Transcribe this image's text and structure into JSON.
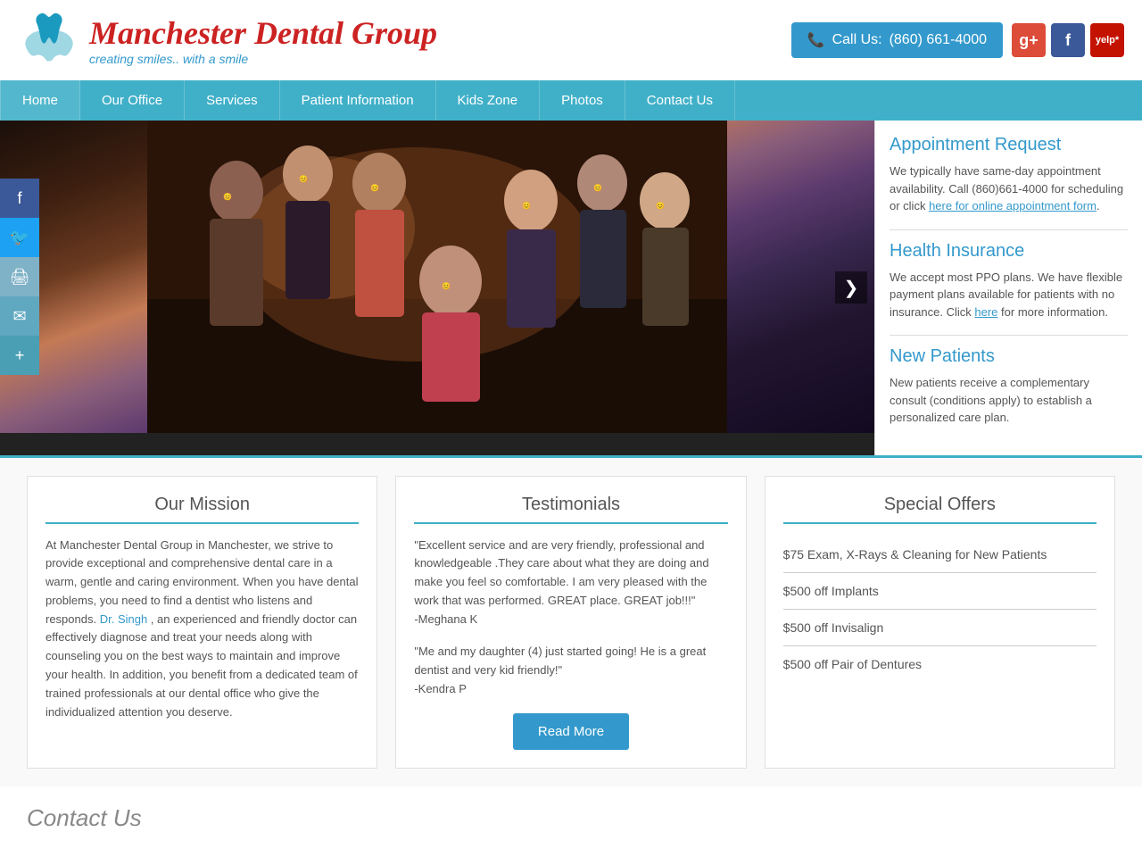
{
  "topbar": {
    "call_label": "Call Us:",
    "phone": "(860) 661-4000",
    "logo_name": "Manchester Dental Group",
    "logo_tagline": "creating smiles.. with a smile"
  },
  "social": {
    "google_label": "g+",
    "facebook_label": "f",
    "yelp_label": "yelp"
  },
  "nav": {
    "items": [
      {
        "label": "Home",
        "active": true
      },
      {
        "label": "Our Office"
      },
      {
        "label": "Services"
      },
      {
        "label": "Patient Information"
      },
      {
        "label": "Kids Zone"
      },
      {
        "label": "Photos"
      },
      {
        "label": "Contact Us"
      }
    ]
  },
  "sidebar": {
    "appointment": {
      "title": "Appointment Request",
      "text": "We typically have same-day appointment availability. Call (860)661-4000 for scheduling or click",
      "link_text": "here for online appointment form",
      "text_after": "."
    },
    "insurance": {
      "title": "Health Insurance",
      "text_before": "We accept most PPO plans. We have flexible payment plans available for patients with no insurance. Click",
      "link_text": "here",
      "text_after": " for more information."
    },
    "new_patients": {
      "title": "New Patients",
      "text": "New patients receive a complementary consult (conditions apply) to establish a personalized care plan."
    }
  },
  "social_side": {
    "facebook": "f",
    "twitter": "t",
    "print": "🖨",
    "email": "✉",
    "plus": "+"
  },
  "mission": {
    "title": "Our Mission",
    "text_before": "At Manchester Dental Group in Manchester, we strive to provide exceptional and comprehensive dental care in a warm, gentle and caring environment. When you have dental problems, you need to find a dentist who listens and responds.",
    "link_text": "Dr. Singh",
    "text_after": ", an experienced and friendly doctor can effectively diagnose and treat your needs along with counseling you on the best ways to maintain and improve your health. In addition, you benefit from a dedicated team of trained professionals at our dental office who give the individualized attention you deserve."
  },
  "testimonials": {
    "title": "Testimonials",
    "items": [
      {
        "quote": "\"Excellent service and are very friendly, professional and knowledgeable .They care about what they are doing and make you feel so comfortable. I am very pleased with the work that was performed. GREAT place. GREAT job!!!\"",
        "author": "-Meghana K"
      },
      {
        "quote": "\"Me and my daughter (4) just started going! He is a great dentist and very kid friendly!\"",
        "author": "-Kendra P"
      }
    ],
    "read_more": "Read More"
  },
  "special_offers": {
    "title": "Special Offers",
    "items": [
      "$75 Exam, X-Rays & Cleaning for New Patients",
      "$500 off Implants",
      "$500 off Invisalign",
      "$500 off Pair of Dentures"
    ]
  },
  "contact_section": {
    "title": "Contact Us"
  }
}
